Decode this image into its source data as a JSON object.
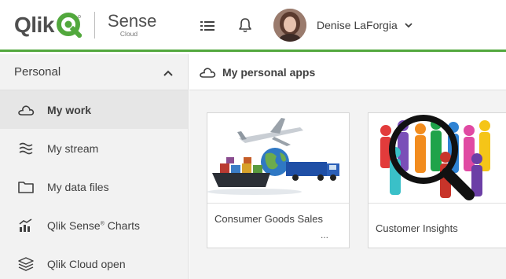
{
  "header": {
    "brand": "Qlik",
    "product_name": "Sense",
    "product_sub": "Cloud",
    "user_name": "Denise LaForgia"
  },
  "sidebar": {
    "section_label": "Personal",
    "items": [
      {
        "label": "My work",
        "icon": "cloud-icon",
        "active": true
      },
      {
        "label": "My stream",
        "icon": "stream-icon",
        "active": false
      },
      {
        "label": "My data files",
        "icon": "folder-icon",
        "active": false
      },
      {
        "label": "Qlik Sense",
        "label_sup": "®",
        "label_after": " Charts",
        "icon": "charts-icon",
        "active": false
      },
      {
        "label": "Qlik Cloud open",
        "icon": "stack-icon",
        "active": false
      }
    ]
  },
  "main": {
    "title": "My personal apps",
    "apps": [
      {
        "title": "Consumer Goods Sales",
        "more": "..."
      },
      {
        "title": "Customer Insights"
      }
    ]
  },
  "colors": {
    "accent": "#52a83d",
    "sidebar_bg": "#f2f2f2",
    "active_item_bg": "#e6e6e6",
    "content_bg": "#f3f3f3"
  }
}
